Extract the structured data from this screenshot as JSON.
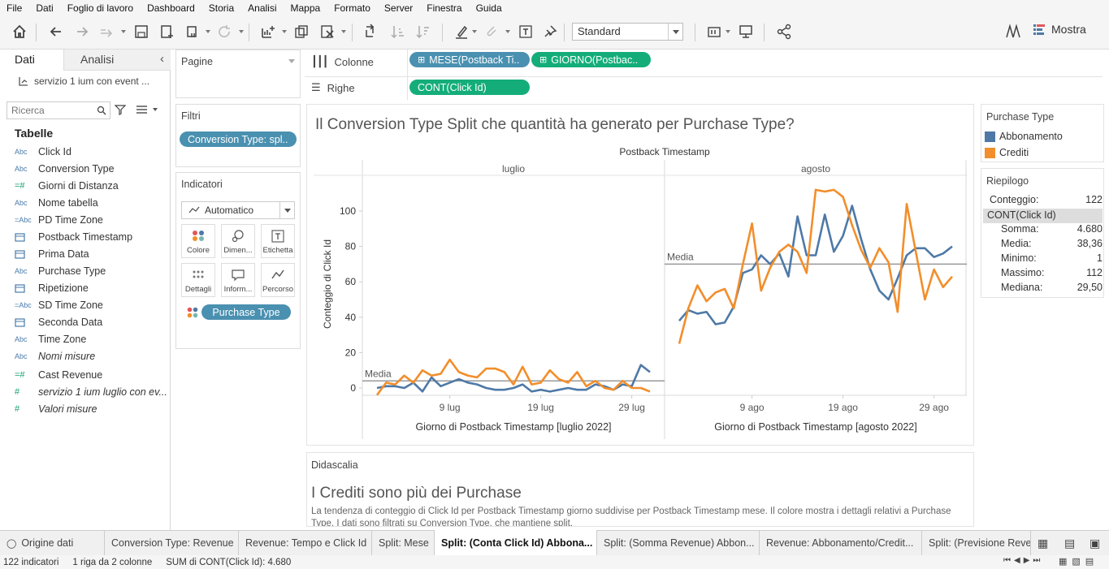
{
  "menu": [
    "File",
    "Dati",
    "Foglio di lavoro",
    "Dashboard",
    "Storia",
    "Analisi",
    "Mappa",
    "Formato",
    "Server",
    "Finestra",
    "Guida"
  ],
  "toolbar": {
    "fit_select": "Standard",
    "show_me": "Mostra"
  },
  "left_pane": {
    "tab_data": "Dati",
    "tab_analytics": "Analisi",
    "datasource": "servizio 1 ium con event ...",
    "search_placeholder": "Ricerca",
    "tables_heading": "Tabelle",
    "fields": [
      {
        "type": "Abc",
        "name": "Click Id",
        "italic": false
      },
      {
        "type": "Abc",
        "name": "Conversion Type",
        "italic": false
      },
      {
        "type": "=#",
        "name": "Giorni di Distanza",
        "italic": false
      },
      {
        "type": "Abc",
        "name": "Nome tabella",
        "italic": false
      },
      {
        "type": "=Abc",
        "name": "PD Time Zone",
        "italic": false
      },
      {
        "type": "cal",
        "name": "Postback Timestamp",
        "italic": false
      },
      {
        "type": "=cal",
        "name": "Prima Data",
        "italic": false
      },
      {
        "type": "Abc",
        "name": "Purchase Type",
        "italic": false
      },
      {
        "type": "=cal",
        "name": "Ripetizione",
        "italic": false
      },
      {
        "type": "=Abc",
        "name": "SD Time Zone",
        "italic": false
      },
      {
        "type": "=cal",
        "name": "Seconda Data",
        "italic": false
      },
      {
        "type": "Abc",
        "name": "Time Zone",
        "italic": false
      },
      {
        "type": "Abc",
        "name": "Nomi misure",
        "italic": true
      },
      {
        "type": "=#",
        "name": "Cast Revenue",
        "italic": false
      },
      {
        "type": "#",
        "name": "servizio 1 ium luglio con ev...",
        "italic": true
      },
      {
        "type": "#",
        "name": "Valori misure",
        "italic": true
      }
    ]
  },
  "cards": {
    "pages": "Pagine",
    "filters": "Filtri",
    "filter_pill": "Conversion Type: spl..",
    "marks": "Indicatori",
    "mark_type": "Automatico",
    "mark_buttons": [
      "Colore",
      "Dimen...",
      "Etichetta",
      "Dettagli",
      "Inform...",
      "Percorso"
    ],
    "color_pill": "Purchase Type"
  },
  "shelves": {
    "columns_label": "Colonne",
    "rows_label": "Righe",
    "col_pill_1": "MESE(Postback Ti..",
    "col_pill_2": "GIORNO(Postbac..",
    "row_pill": "CONT(Click Id)"
  },
  "viz": {
    "title": "Il Conversion Type Split che quantità ha generato per Purchase Type?",
    "header": "Postback Timestamp",
    "avg_label": "Media"
  },
  "legend": {
    "title": "Purchase Type",
    "items": [
      {
        "label": "Abbonamento",
        "color": "#4e79a7"
      },
      {
        "label": "Crediti",
        "color": "#f28e2b"
      }
    ]
  },
  "summary": {
    "title": "Riepilogo",
    "count_label": "Conteggio:",
    "count_value": "122",
    "measure": "CONT(Click Id)",
    "rows": [
      {
        "k": "Somma:",
        "v": "4.680"
      },
      {
        "k": "Media:",
        "v": "38,36"
      },
      {
        "k": "Minimo:",
        "v": "1"
      },
      {
        "k": "Massimo:",
        "v": "112"
      },
      {
        "k": "Mediana:",
        "v": "29,50"
      }
    ]
  },
  "caption": {
    "label": "Didascalia",
    "title": "I Crediti sono più dei Purchase",
    "text": "La tendenza di conteggio di Click Id per Postback Timestamp giorno suddivise per Postback Timestamp mese. Il colore mostra i dettagli relativi a Purchase Type. I dati sono filtrati su Conversion Type, che mantiene split."
  },
  "sheet_tabs": [
    "Origine dati",
    "Conversion Type: Revenue",
    "Revenue: Tempo e Click Id",
    "Split: Mese",
    "Split: (Conta Click Id) Abbona...",
    "Split: (Somma Revenue) Abbon...",
    "Revenue: Abbonamento/Credit...",
    "Split: (Previsione Rever"
  ],
  "status": {
    "marks": "122 indicatori",
    "rows": "1 riga da 2 colonne",
    "sum": "SUM di CONT(Click Id): 4.680"
  },
  "chart_data": {
    "type": "line",
    "title": "Il Conversion Type Split che quantità ha generato per Purchase Type?",
    "ylabel": "Conteggio di Click Id",
    "ylim": [
      0,
      115
    ],
    "yticks": [
      0,
      20,
      40,
      60,
      80,
      100
    ],
    "grid": false,
    "legend_position": "right",
    "panels": [
      {
        "month": "luglio",
        "xlabel": "Giorno di Postback Timestamp [luglio 2022]",
        "days": [
          1,
          2,
          3,
          4,
          5,
          6,
          7,
          8,
          9,
          10,
          11,
          12,
          13,
          14,
          15,
          16,
          17,
          18,
          19,
          20,
          21,
          22,
          23,
          24,
          25,
          26,
          27,
          28,
          29,
          30,
          31
        ],
        "tick_days": [
          9,
          19,
          29
        ],
        "tick_labels": [
          "9 lug",
          "19 lug",
          "29 lug"
        ],
        "average": 4,
        "series": [
          {
            "name": "Abbonamento",
            "values": [
              0,
              1,
              1,
              0,
              3,
              -2,
              6,
              1,
              3,
              5,
              3,
              2,
              0,
              -1,
              -1,
              0,
              2,
              -2,
              -1,
              -2,
              -1,
              0,
              -1,
              -1,
              2,
              1,
              -1,
              2,
              1,
              13,
              9
            ]
          },
          {
            "name": "Crediti",
            "values": [
              -4,
              3,
              2,
              7,
              3,
              10,
              7,
              8,
              16,
              9,
              7,
              6,
              11,
              11,
              9,
              2,
              12,
              2,
              3,
              10,
              5,
              3,
              9,
              1,
              4,
              0,
              -1,
              4,
              0,
              0,
              -2
            ]
          }
        ]
      },
      {
        "month": "agosto",
        "xlabel": "Giorno di Postback Timestamp [agosto 2022]",
        "days": [
          1,
          2,
          3,
          4,
          5,
          6,
          7,
          8,
          9,
          10,
          11,
          12,
          13,
          14,
          15,
          16,
          17,
          18,
          19,
          20,
          21,
          22,
          23,
          24,
          25,
          26,
          27,
          28,
          29,
          30,
          31
        ],
        "tick_days": [
          9,
          19,
          29
        ],
        "tick_labels": [
          "9 ago",
          "19 ago",
          "29 ago"
        ],
        "average": 70,
        "series": [
          {
            "name": "Abbonamento",
            "values": [
              38,
              44,
              42,
              43,
              36,
              37,
              46,
              65,
              67,
              75,
              70,
              76,
              63,
              97,
              75,
              75,
              98,
              77,
              86,
              103,
              84,
              67,
              55,
              50,
              62,
              75,
              79,
              79,
              74,
              76,
              80
            ]
          },
          {
            "name": "Crediti",
            "values": [
              25,
              45,
              58,
              49,
              54,
              56,
              45,
              70,
              93,
              55,
              68,
              77,
              81,
              77,
              65,
              112,
              111,
              112,
              108,
              92,
              78,
              68,
              79,
              71,
              43,
              104,
              77,
              50,
              67,
              57,
              63
            ]
          }
        ]
      }
    ]
  }
}
